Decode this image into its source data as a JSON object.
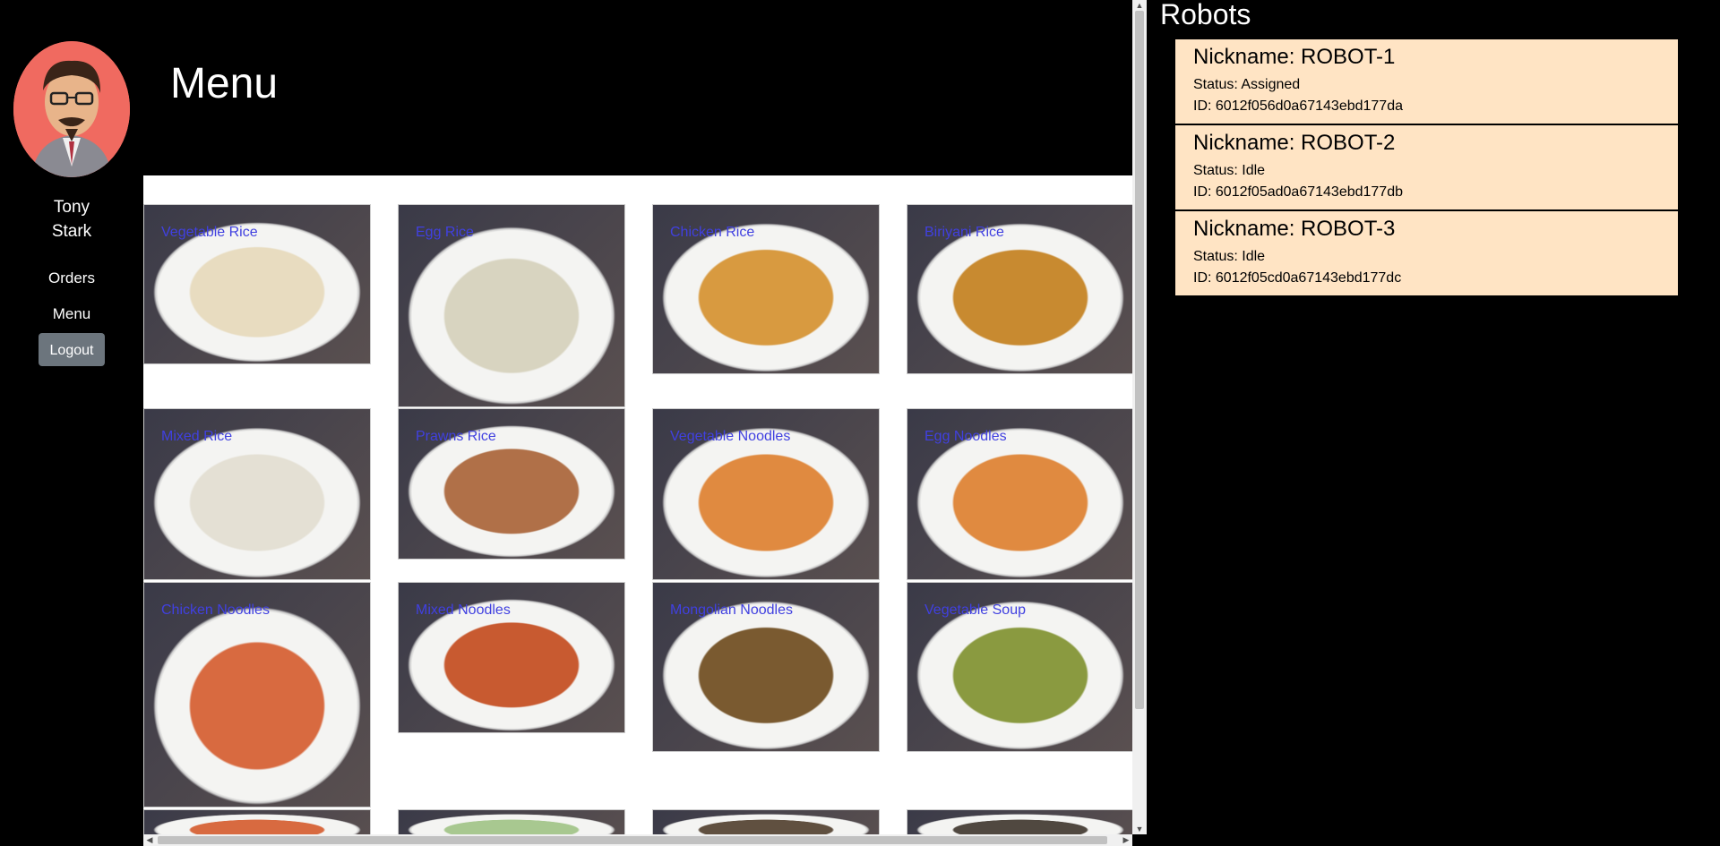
{
  "user": {
    "name": "Tony Stark"
  },
  "nav": {
    "orders_label": "Orders",
    "menu_label": "Menu",
    "logout_label": "Logout"
  },
  "header": {
    "title": "Menu"
  },
  "menu": {
    "items": [
      {
        "name": "Vegetable Rice",
        "dish_color": "#e8dcc0"
      },
      {
        "name": "Egg Rice",
        "dish_color": "#d8d4c0"
      },
      {
        "name": "Chicken Rice",
        "dish_color": "#d89a40"
      },
      {
        "name": "Biriyani Rice",
        "dish_color": "#c88a30"
      },
      {
        "name": "Mixed Rice",
        "dish_color": "#e4e0d4"
      },
      {
        "name": "Prawns Rice",
        "dish_color": "#b07048"
      },
      {
        "name": "Vegetable Noodles",
        "dish_color": "#e08a40"
      },
      {
        "name": "Egg Noodles",
        "dish_color": "#e08a40"
      },
      {
        "name": "Chicken Noodles",
        "dish_color": "#d86a40"
      },
      {
        "name": "Mixed Noodles",
        "dish_color": "#c85a30"
      },
      {
        "name": "Mongolian Noodles",
        "dish_color": "#7a5a30"
      },
      {
        "name": "Vegetable Soup",
        "dish_color": "#8a9a40"
      },
      {
        "name": "",
        "dish_color": "#d86a40"
      },
      {
        "name": "",
        "dish_color": "#a8c890"
      },
      {
        "name": "",
        "dish_color": "#605040"
      },
      {
        "name": "",
        "dish_color": "#504840"
      }
    ]
  },
  "robots": {
    "title": "Robots",
    "list": [
      {
        "nickname": "Nickname: ROBOT-1",
        "status": "Status: Assigned",
        "id": "ID: 6012f056d0a67143ebd177da"
      },
      {
        "nickname": "Nickname: ROBOT-2",
        "status": "Status: Idle",
        "id": "ID: 6012f05ad0a67143ebd177db"
      },
      {
        "nickname": "Nickname: ROBOT-3",
        "status": "Status: Idle",
        "id": "ID: 6012f05cd0a67143ebd177dc"
      }
    ]
  },
  "colors": {
    "background": "#000000",
    "robot_card": "#ffe4c4",
    "menu_label": "#4040e0",
    "logout_button": "#6c757d",
    "avatar_bg": "#f06a60"
  }
}
